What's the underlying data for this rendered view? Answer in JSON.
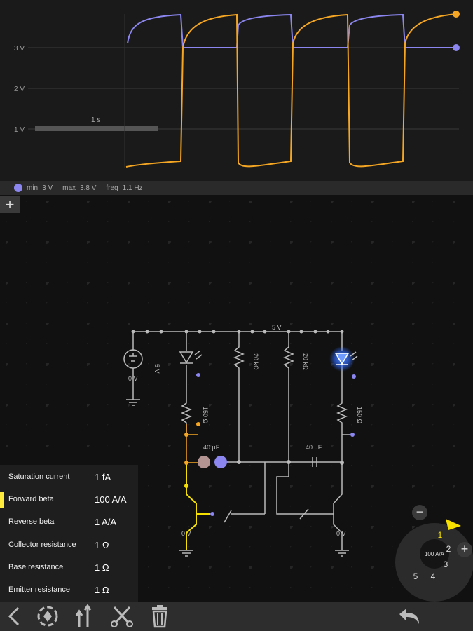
{
  "scope": {
    "y_labels": [
      "3 V",
      "2 V",
      "1 V"
    ],
    "time_label": "1 s",
    "trace_colors": {
      "purple": "#8b86f0",
      "orange": "#f5a623"
    }
  },
  "scope_info": {
    "min_label": "min",
    "min_value": "3 V",
    "max_label": "max",
    "max_value": "3.8 V",
    "freq_label": "freq",
    "freq_value": "1.1 Hz",
    "dot_color": "#8b86f0"
  },
  "add_scope_label": "+",
  "circuit": {
    "supply_top_label": "5 V",
    "source_label": "5 V",
    "ground_labels": [
      "0 V",
      "0 V",
      "0 V"
    ],
    "resistors": [
      "150 Ω",
      "20 kΩ",
      "20 kΩ",
      "150 Ω"
    ],
    "capacitors": [
      "40 µF",
      "40 µF"
    ],
    "led_on_color": "#2f6bff"
  },
  "properties": [
    {
      "name": "Saturation current",
      "value": "1 fA",
      "selected": false
    },
    {
      "name": "Forward beta",
      "value": "100 A/A",
      "selected": true
    },
    {
      "name": "Reverse beta",
      "value": "1 A/A",
      "selected": false
    },
    {
      "name": "Collector resistance",
      "value": "1 Ω",
      "selected": false
    },
    {
      "name": "Base resistance",
      "value": "1 Ω",
      "selected": false
    },
    {
      "name": "Emitter resistance",
      "value": "1 Ω",
      "selected": false
    }
  ],
  "dial": {
    "center_value": "100 A/A",
    "numbers": [
      "1",
      "2",
      "3",
      "4",
      "5"
    ],
    "minus": "−",
    "plus": "+"
  },
  "toolbar": {
    "icons": [
      "back-icon",
      "rotate-icon",
      "flip-icon",
      "cut-icon",
      "delete-icon",
      "undo-icon"
    ]
  }
}
